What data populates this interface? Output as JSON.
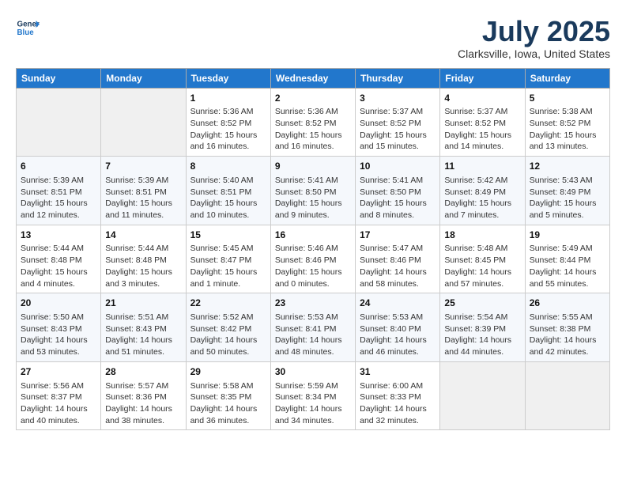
{
  "header": {
    "logo_line1": "General",
    "logo_line2": "Blue",
    "month": "July 2025",
    "location": "Clarksville, Iowa, United States"
  },
  "weekdays": [
    "Sunday",
    "Monday",
    "Tuesday",
    "Wednesday",
    "Thursday",
    "Friday",
    "Saturday"
  ],
  "weeks": [
    [
      {
        "day": "",
        "sunrise": "",
        "sunset": "",
        "daylight": ""
      },
      {
        "day": "",
        "sunrise": "",
        "sunset": "",
        "daylight": ""
      },
      {
        "day": "1",
        "sunrise": "Sunrise: 5:36 AM",
        "sunset": "Sunset: 8:52 PM",
        "daylight": "Daylight: 15 hours and 16 minutes."
      },
      {
        "day": "2",
        "sunrise": "Sunrise: 5:36 AM",
        "sunset": "Sunset: 8:52 PM",
        "daylight": "Daylight: 15 hours and 16 minutes."
      },
      {
        "day": "3",
        "sunrise": "Sunrise: 5:37 AM",
        "sunset": "Sunset: 8:52 PM",
        "daylight": "Daylight: 15 hours and 15 minutes."
      },
      {
        "day": "4",
        "sunrise": "Sunrise: 5:37 AM",
        "sunset": "Sunset: 8:52 PM",
        "daylight": "Daylight: 15 hours and 14 minutes."
      },
      {
        "day": "5",
        "sunrise": "Sunrise: 5:38 AM",
        "sunset": "Sunset: 8:52 PM",
        "daylight": "Daylight: 15 hours and 13 minutes."
      }
    ],
    [
      {
        "day": "6",
        "sunrise": "Sunrise: 5:39 AM",
        "sunset": "Sunset: 8:51 PM",
        "daylight": "Daylight: 15 hours and 12 minutes."
      },
      {
        "day": "7",
        "sunrise": "Sunrise: 5:39 AM",
        "sunset": "Sunset: 8:51 PM",
        "daylight": "Daylight: 15 hours and 11 minutes."
      },
      {
        "day": "8",
        "sunrise": "Sunrise: 5:40 AM",
        "sunset": "Sunset: 8:51 PM",
        "daylight": "Daylight: 15 hours and 10 minutes."
      },
      {
        "day": "9",
        "sunrise": "Sunrise: 5:41 AM",
        "sunset": "Sunset: 8:50 PM",
        "daylight": "Daylight: 15 hours and 9 minutes."
      },
      {
        "day": "10",
        "sunrise": "Sunrise: 5:41 AM",
        "sunset": "Sunset: 8:50 PM",
        "daylight": "Daylight: 15 hours and 8 minutes."
      },
      {
        "day": "11",
        "sunrise": "Sunrise: 5:42 AM",
        "sunset": "Sunset: 8:49 PM",
        "daylight": "Daylight: 15 hours and 7 minutes."
      },
      {
        "day": "12",
        "sunrise": "Sunrise: 5:43 AM",
        "sunset": "Sunset: 8:49 PM",
        "daylight": "Daylight: 15 hours and 5 minutes."
      }
    ],
    [
      {
        "day": "13",
        "sunrise": "Sunrise: 5:44 AM",
        "sunset": "Sunset: 8:48 PM",
        "daylight": "Daylight: 15 hours and 4 minutes."
      },
      {
        "day": "14",
        "sunrise": "Sunrise: 5:44 AM",
        "sunset": "Sunset: 8:48 PM",
        "daylight": "Daylight: 15 hours and 3 minutes."
      },
      {
        "day": "15",
        "sunrise": "Sunrise: 5:45 AM",
        "sunset": "Sunset: 8:47 PM",
        "daylight": "Daylight: 15 hours and 1 minute."
      },
      {
        "day": "16",
        "sunrise": "Sunrise: 5:46 AM",
        "sunset": "Sunset: 8:46 PM",
        "daylight": "Daylight: 15 hours and 0 minutes."
      },
      {
        "day": "17",
        "sunrise": "Sunrise: 5:47 AM",
        "sunset": "Sunset: 8:46 PM",
        "daylight": "Daylight: 14 hours and 58 minutes."
      },
      {
        "day": "18",
        "sunrise": "Sunrise: 5:48 AM",
        "sunset": "Sunset: 8:45 PM",
        "daylight": "Daylight: 14 hours and 57 minutes."
      },
      {
        "day": "19",
        "sunrise": "Sunrise: 5:49 AM",
        "sunset": "Sunset: 8:44 PM",
        "daylight": "Daylight: 14 hours and 55 minutes."
      }
    ],
    [
      {
        "day": "20",
        "sunrise": "Sunrise: 5:50 AM",
        "sunset": "Sunset: 8:43 PM",
        "daylight": "Daylight: 14 hours and 53 minutes."
      },
      {
        "day": "21",
        "sunrise": "Sunrise: 5:51 AM",
        "sunset": "Sunset: 8:43 PM",
        "daylight": "Daylight: 14 hours and 51 minutes."
      },
      {
        "day": "22",
        "sunrise": "Sunrise: 5:52 AM",
        "sunset": "Sunset: 8:42 PM",
        "daylight": "Daylight: 14 hours and 50 minutes."
      },
      {
        "day": "23",
        "sunrise": "Sunrise: 5:53 AM",
        "sunset": "Sunset: 8:41 PM",
        "daylight": "Daylight: 14 hours and 48 minutes."
      },
      {
        "day": "24",
        "sunrise": "Sunrise: 5:53 AM",
        "sunset": "Sunset: 8:40 PM",
        "daylight": "Daylight: 14 hours and 46 minutes."
      },
      {
        "day": "25",
        "sunrise": "Sunrise: 5:54 AM",
        "sunset": "Sunset: 8:39 PM",
        "daylight": "Daylight: 14 hours and 44 minutes."
      },
      {
        "day": "26",
        "sunrise": "Sunrise: 5:55 AM",
        "sunset": "Sunset: 8:38 PM",
        "daylight": "Daylight: 14 hours and 42 minutes."
      }
    ],
    [
      {
        "day": "27",
        "sunrise": "Sunrise: 5:56 AM",
        "sunset": "Sunset: 8:37 PM",
        "daylight": "Daylight: 14 hours and 40 minutes."
      },
      {
        "day": "28",
        "sunrise": "Sunrise: 5:57 AM",
        "sunset": "Sunset: 8:36 PM",
        "daylight": "Daylight: 14 hours and 38 minutes."
      },
      {
        "day": "29",
        "sunrise": "Sunrise: 5:58 AM",
        "sunset": "Sunset: 8:35 PM",
        "daylight": "Daylight: 14 hours and 36 minutes."
      },
      {
        "day": "30",
        "sunrise": "Sunrise: 5:59 AM",
        "sunset": "Sunset: 8:34 PM",
        "daylight": "Daylight: 14 hours and 34 minutes."
      },
      {
        "day": "31",
        "sunrise": "Sunrise: 6:00 AM",
        "sunset": "Sunset: 8:33 PM",
        "daylight": "Daylight: 14 hours and 32 minutes."
      },
      {
        "day": "",
        "sunrise": "",
        "sunset": "",
        "daylight": ""
      },
      {
        "day": "",
        "sunrise": "",
        "sunset": "",
        "daylight": ""
      }
    ]
  ]
}
